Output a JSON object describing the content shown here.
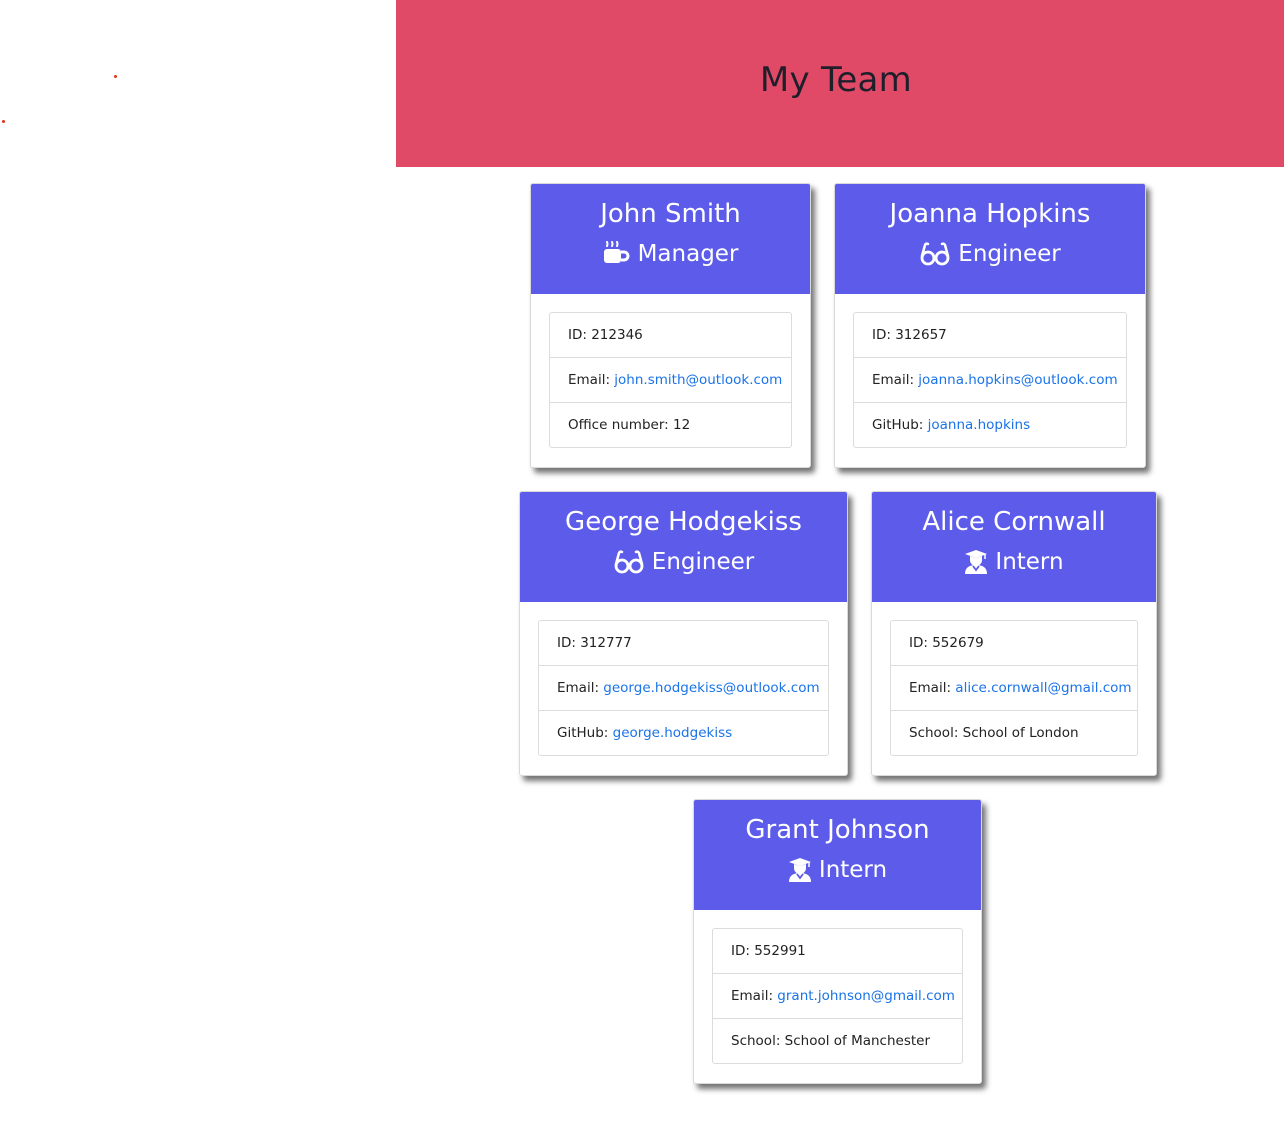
{
  "header": {
    "title": "My Team"
  },
  "colors": {
    "header_bg": "#e04a67",
    "card_header_bg": "#5d5cea",
    "link": "#1a73e8"
  },
  "labels": {
    "id": "ID: ",
    "email": "Email: ",
    "office": "Office number: ",
    "github": "GitHub: ",
    "school": "School: "
  },
  "team": [
    {
      "name": "John Smith",
      "role": "Manager",
      "icon": "coffee-mug-icon",
      "id": "212346",
      "email": "john.smith@outlook.com",
      "extra_label": "Office number: ",
      "extra_value": "12"
    },
    {
      "name": "Joanna Hopkins",
      "role": "Engineer",
      "icon": "glasses-icon",
      "id": "312657",
      "email": "joanna.hopkins@outlook.com",
      "extra_label": "GitHub: ",
      "extra_value": "joanna.hopkins"
    },
    {
      "name": "George Hodgekiss",
      "role": "Engineer",
      "icon": "glasses-icon",
      "id": "312777",
      "email": "george.hodgekiss@outlook.com",
      "extra_label": "GitHub: ",
      "extra_value": "george.hodgekiss"
    },
    {
      "name": "Alice Cornwall",
      "role": "Intern",
      "icon": "graduate-icon",
      "id": "552679",
      "email": "alice.cornwall@gmail.com",
      "extra_label": "School: ",
      "extra_value": "School of London"
    },
    {
      "name": "Grant Johnson",
      "role": "Intern",
      "icon": "graduate-icon",
      "id": "552991",
      "email": "grant.johnson@gmail.com",
      "extra_label": "School: ",
      "extra_value": "School of Manchester"
    }
  ]
}
